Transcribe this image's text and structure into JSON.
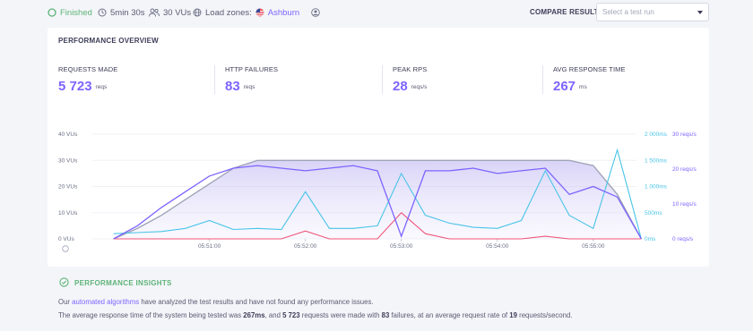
{
  "topbar": {
    "status": "Finished",
    "duration": "5min 30s",
    "vus": "30 VUs",
    "load_zones_label": "Load zones:",
    "load_zone": "Ashburn",
    "compare_label": "COMPARE RESULT",
    "compare_placeholder": "Select a test run"
  },
  "overview": {
    "title": "PERFORMANCE OVERVIEW",
    "metrics": [
      {
        "label": "REQUESTS MADE",
        "value": "5 723",
        "unit": "reqs"
      },
      {
        "label": "HTTP FAILURES",
        "value": "83",
        "unit": "reqs"
      },
      {
        "label": "PEAK RPS",
        "value": "28",
        "unit": "reqs/s"
      },
      {
        "label": "AVG RESPONSE TIME",
        "value": "267",
        "unit": "ms"
      }
    ]
  },
  "chart_data": {
    "type": "area",
    "x_tick_labels": [
      "05:51:00",
      "05:52:00",
      "05:53:00",
      "05:54:00",
      "05:55:00"
    ],
    "y_left_ticks": [
      "40 VUs",
      "30 VUs",
      "20 VUs",
      "10 VUs",
      "0 VUs"
    ],
    "y_right1_ticks": [
      "2 000ms",
      "1 500ms",
      "1 000ms",
      "500ms",
      "0ms"
    ],
    "y_right2_ticks": [
      "30 reqs/s",
      "20 reqs/s",
      "10 reqs/s",
      "0 reqs/s"
    ],
    "colors": {
      "vus": "#9fa4b8",
      "rps": "#7d64ff",
      "response_time": "#48c4e8",
      "failures": "#f0557a"
    },
    "x_minutes": [
      0,
      0.25,
      0.5,
      0.75,
      1,
      1.25,
      1.5,
      1.75,
      2,
      2.25,
      2.5,
      2.75,
      3,
      3.25,
      3.5,
      3.75,
      4,
      4.25,
      4.5,
      4.75,
      5,
      5.25,
      5.5
    ],
    "series": [
      {
        "key": "vus",
        "axis": "left",
        "values": [
          0,
          4,
          9,
          15,
          21,
          27,
          30,
          30,
          30,
          30,
          30,
          30,
          30,
          30,
          30,
          30,
          30,
          30,
          30,
          30,
          28,
          17,
          0
        ]
      },
      {
        "key": "rps",
        "values": [
          0,
          5,
          12,
          18,
          24,
          27,
          28,
          27,
          26,
          27,
          28,
          26,
          1,
          26,
          26,
          27,
          25,
          26,
          27,
          17,
          20,
          16,
          0
        ]
      },
      {
        "key": "response_time",
        "values": [
          100,
          120,
          140,
          200,
          350,
          180,
          200,
          180,
          900,
          200,
          200,
          250,
          1250,
          450,
          300,
          220,
          200,
          350,
          1300,
          450,
          200,
          1700,
          0
        ]
      },
      {
        "key": "failures",
        "values": [
          0,
          0,
          0,
          0,
          0,
          0,
          0,
          0,
          3,
          0,
          0,
          0,
          10,
          2,
          0,
          0,
          0,
          0,
          1,
          0,
          0,
          0,
          0
        ]
      }
    ]
  },
  "insights": {
    "title": "PERFORMANCE INSIGHTS",
    "line1_pre": "Our ",
    "line1_link": "automated algorithms",
    "line1_post": " have analyzed the test results and have not found any performance issues.",
    "line2_a": "The average response time of the system being tested was ",
    "line2_b": "267ms",
    "line2_c": ", and ",
    "line2_d": "5 723",
    "line2_e": " requests were made with ",
    "line2_f": "83",
    "line2_g": " failures, at an average request rate of ",
    "line2_h": "19",
    "line2_i": " requests/second."
  }
}
